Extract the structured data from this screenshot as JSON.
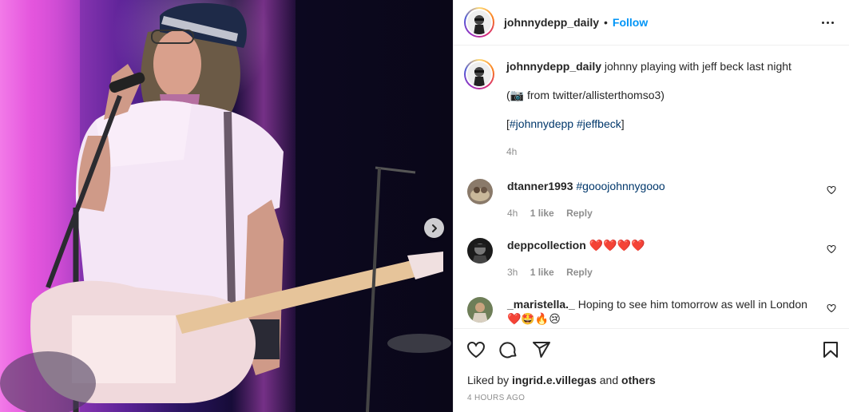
{
  "post": {
    "username": "johnnydepp_daily",
    "follow_label": "Follow",
    "separator": "•",
    "caption": {
      "username": "johnnydepp_daily",
      "text": "johnny playing with jeff beck last night",
      "line2_emoji": "📷",
      "line2_text": " from twitter/allisterthomso3)",
      "line2_open": "(",
      "line3_open": "[",
      "line3_tags": "#johnnydepp #jeffbeck",
      "line3_close": "]",
      "time": "4h"
    },
    "comments": [
      {
        "username": "dtanner1993",
        "text": "#gooojohnnygooo",
        "time": "4h",
        "likes": "1 like",
        "reply": "Reply"
      },
      {
        "username": "deppcollection",
        "text": "❤️❤️❤️❤️",
        "time": "3h",
        "likes": "1 like",
        "reply": "Reply"
      },
      {
        "username": "_maristella._",
        "text": "Hoping to see him tomorrow as well in London",
        "text2": "❤️🤩🔥😢"
      }
    ],
    "liked_by_prefix": "Liked by ",
    "liked_by_user": "ingrid.e.villegas",
    "liked_by_and": " and ",
    "liked_by_others": "others",
    "posted_ago": "4 HOURS AGO"
  },
  "icons": {
    "more": "more-options-icon",
    "next": "chevron-right-icon",
    "like": "heart-icon",
    "comment": "comment-icon",
    "share": "share-icon",
    "save": "bookmark-icon"
  },
  "colors": {
    "follow": "#0095f6",
    "hashtag": "#00376b",
    "muted": "#8e8e8e"
  }
}
